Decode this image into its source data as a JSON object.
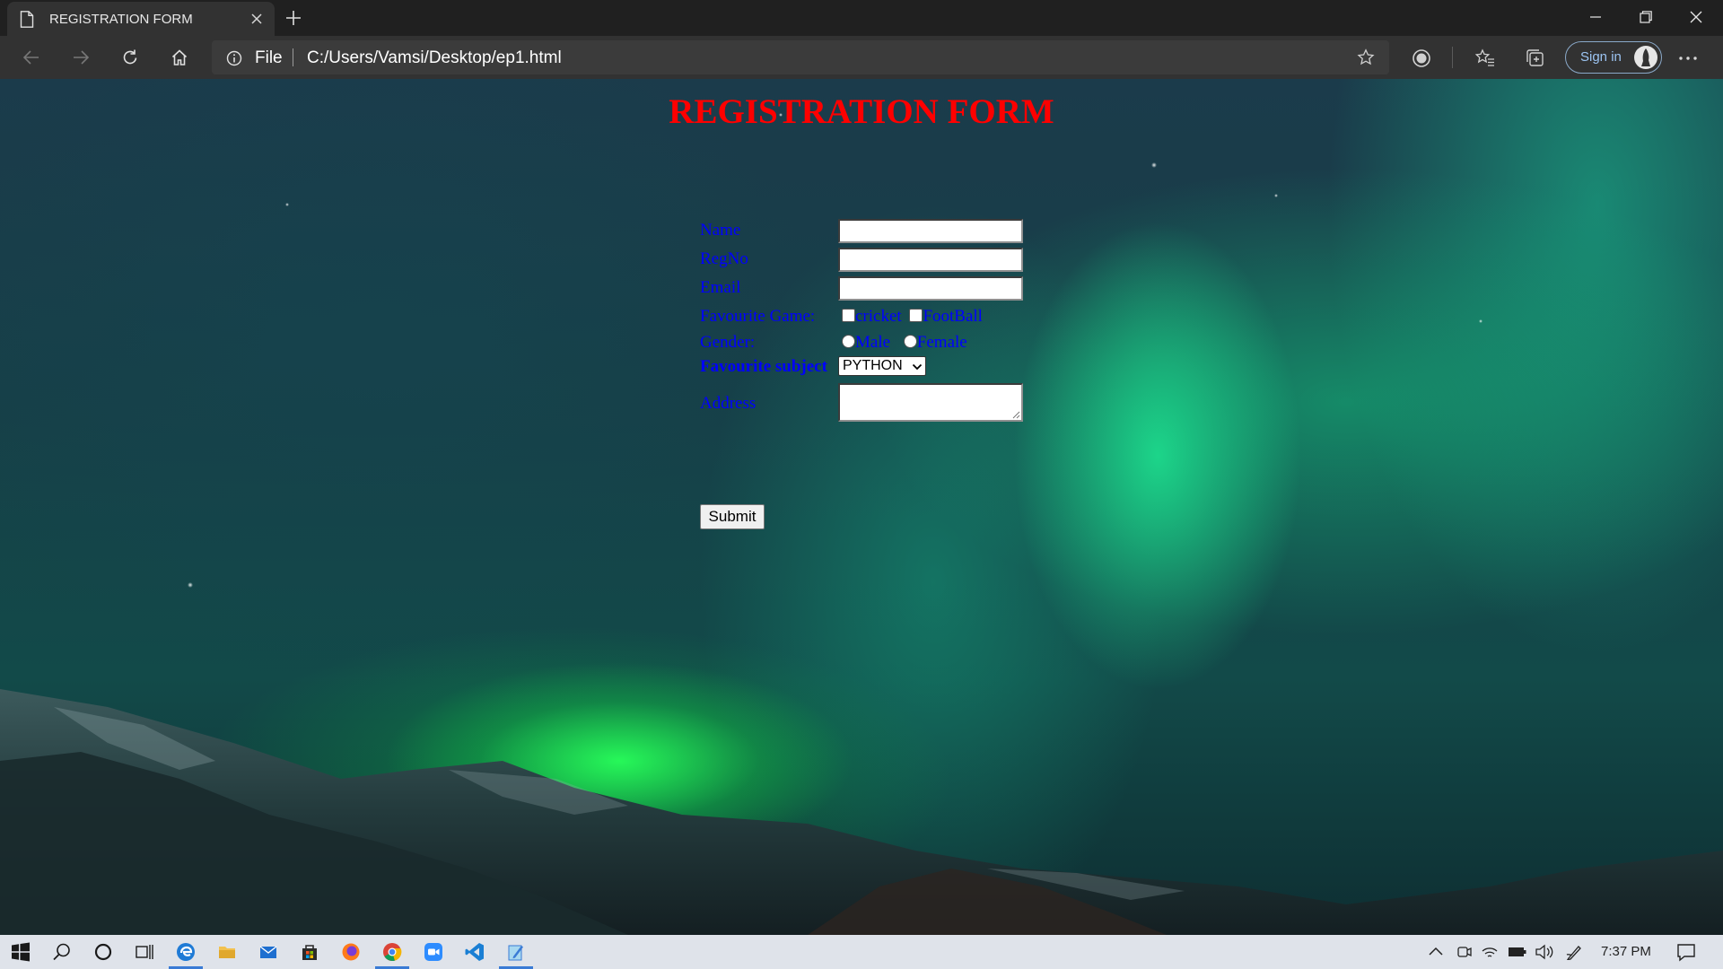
{
  "browser": {
    "tab_title": "REGISTRATION FORM",
    "scheme": "File",
    "url": "C:/Users/Vamsi/Desktop/ep1.html",
    "sign_in_label": "Sign in",
    "accent_color": "#9cc4f2"
  },
  "page": {
    "title": "REGISTRATION FORM",
    "title_color": "#ff0000",
    "label_color": "#0000ff",
    "labels": {
      "name": "Name",
      "regno": "RegNo",
      "email": "Email",
      "game": "Favourite Game:",
      "gender": "Gender:",
      "subject": "Favourite subject",
      "address": "Address"
    },
    "fields": {
      "name_value": "",
      "regno_value": "",
      "email_value": "",
      "address_value": ""
    },
    "games": [
      "cricket",
      "FootBall"
    ],
    "genders": [
      "Male",
      "Female"
    ],
    "subject_selected": "PYTHON",
    "submit_label": "Submit"
  },
  "taskbar": {
    "apps": [
      "windows-start",
      "search",
      "cortana",
      "task-view",
      "edge",
      "file-explorer",
      "mail",
      "store",
      "firefox",
      "chrome",
      "zoom",
      "vscode",
      "notepad"
    ],
    "clock": "7:37 PM"
  }
}
